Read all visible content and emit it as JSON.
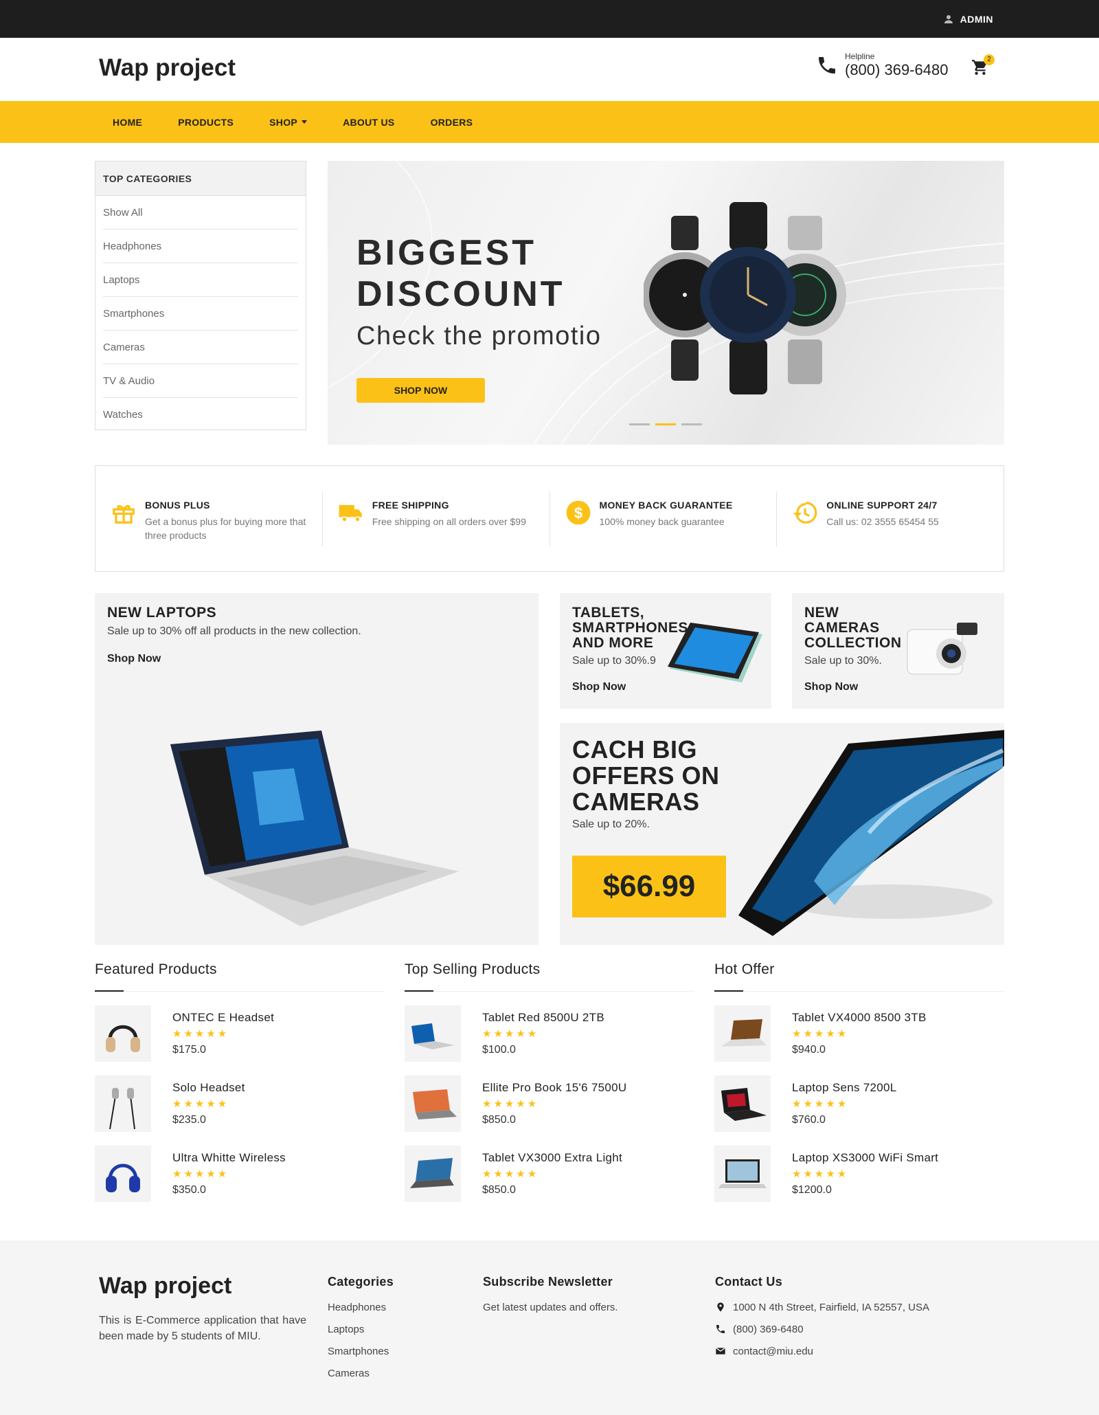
{
  "topbar": {
    "admin_label": "ADMIN"
  },
  "header": {
    "logo": "Wap project",
    "helpline_label": "Helpline",
    "helpline_number": "(800) 369-6480",
    "cart_count": "2"
  },
  "nav": {
    "items": [
      {
        "label": "HOME"
      },
      {
        "label": "PRODUCTS"
      },
      {
        "label": "SHOP"
      },
      {
        "label": "ABOUT US"
      },
      {
        "label": "ORDERS"
      }
    ]
  },
  "categories": {
    "title": "TOP CATEGORIES",
    "items": [
      "Show All",
      "Headphones",
      "Laptops",
      "Smartphones",
      "Cameras",
      "TV & Audio",
      "Watches"
    ]
  },
  "hero": {
    "title_line1": "BIGGEST",
    "title_line2": "DISCOUNT",
    "subtitle": "Check the promotio",
    "button": "SHOP NOW",
    "active_slide": 2,
    "slide_count": 3
  },
  "features": [
    {
      "title": "BONUS PLUS",
      "desc": "Get a bonus plus for buying more that three products",
      "icon": "gift-icon"
    },
    {
      "title": "FREE SHIPPING",
      "desc": "Free shipping on all orders over $99",
      "icon": "truck-icon"
    },
    {
      "title": "MONEY BACK GUARANTEE",
      "desc": "100% money back guarantee",
      "icon": "dollar-coin-icon"
    },
    {
      "title": "ONLINE SUPPORT 24/7",
      "desc": "Call us: 02 3555 65454 55",
      "icon": "history-clock-icon"
    }
  ],
  "promos": {
    "laptops": {
      "title": "NEW LAPTOPS",
      "sub": "Sale up to 30% off all products in the new collection.",
      "link": "Shop Now"
    },
    "tablets": {
      "title_l1": "TABLETS,",
      "title_l2": "SMARTPHONES",
      "title_l3": "AND MORE",
      "sub": "Sale up to 30%.9",
      "link": "Shop Now"
    },
    "cameras": {
      "title_l1": "NEW",
      "title_l2": "CAMERAS",
      "title_l3": "COLLECTION",
      "sub": "Sale up to 30%.",
      "link": "Shop Now"
    },
    "bigoffer": {
      "title_l1": "CACH BIG",
      "title_l2": "OFFERS ON",
      "title_l3": "CAMERAS",
      "sub": "Sale up to 20%.",
      "price": "$66.99"
    }
  },
  "lists": {
    "featured": {
      "title": "Featured Products",
      "items": [
        {
          "name": "ONTEC E Headset",
          "stars": "★★★★★",
          "price": "$175.0",
          "icon": "headphones-icon"
        },
        {
          "name": "Solo Headset",
          "stars": "★★★★★",
          "price": "$235.0",
          "icon": "earphones-icon"
        },
        {
          "name": "Ultra Whitte Wireless",
          "stars": "★★★★★",
          "price": "$350.0",
          "icon": "headphones-icon"
        }
      ]
    },
    "topselling": {
      "title": "Top Selling Products",
      "items": [
        {
          "name": "Tablet Red 8500U 2TB",
          "stars": "★★★★★",
          "price": "$100.0",
          "icon": "laptop-icon"
        },
        {
          "name": "Ellite Pro Book 15'6 7500U",
          "stars": "★★★★★",
          "price": "$850.0",
          "icon": "laptop-icon"
        },
        {
          "name": "Tablet VX3000 Extra Light",
          "stars": "★★★★★",
          "price": "$850.0",
          "icon": "laptop-icon"
        }
      ]
    },
    "hotoffer": {
      "title": "Hot Offer",
      "items": [
        {
          "name": "Tablet VX4000 8500 3TB",
          "stars": "★★★★★",
          "price": "$940.0",
          "icon": "laptop-icon"
        },
        {
          "name": "Laptop Sens 7200L",
          "stars": "★★★★★",
          "price": "$760.0",
          "icon": "laptop-icon"
        },
        {
          "name": "Laptop XS3000 WiFi Smart",
          "stars": "★★★★★",
          "price": "$1200.0",
          "icon": "laptop-icon"
        }
      ]
    }
  },
  "footer": {
    "logo": "Wap project",
    "desc": "This is E-Commerce application that have been made by 5 students of MIU.",
    "categories_title": "Categories",
    "categories": [
      "Headphones",
      "Laptops",
      "Smartphones",
      "Cameras"
    ],
    "newsletter_title": "Subscribe Newsletter",
    "newsletter_text": "Get latest updates and offers.",
    "contact_title": "Contact Us",
    "address": "1000 N 4th Street, Fairfield, IA 52557, USA",
    "phone": "(800) 369-6480",
    "email": "contact@miu.edu"
  },
  "colors": {
    "accent": "#fbc117",
    "topbar": "#1e1e1e",
    "panel": "#f3f3f3"
  }
}
